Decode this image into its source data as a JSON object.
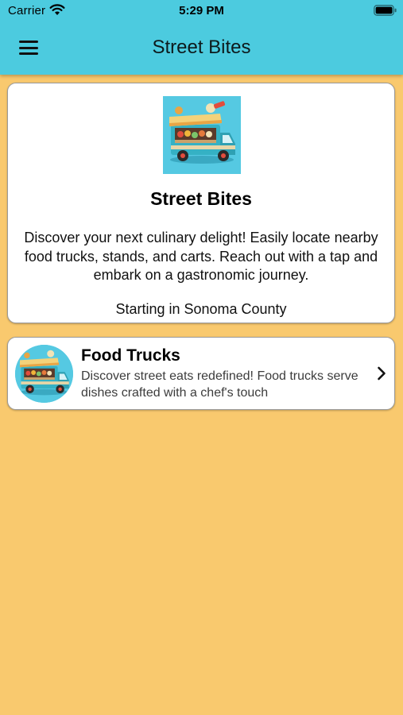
{
  "status_bar": {
    "carrier": "Carrier",
    "time": "5:29 PM",
    "icons": [
      "wifi-icon",
      "battery-icon"
    ]
  },
  "nav": {
    "title": "Street Bites",
    "menu_icon": "hamburger-menu-icon"
  },
  "intro": {
    "image": "food-truck-illustration",
    "title": "Street Bites",
    "description": "Discover your next culinary delight! Easily locate nearby food trucks, stands, and carts. Reach out with a tap and embark on a gastronomic journey.",
    "location": "Starting in Sonoma County"
  },
  "categories": [
    {
      "image": "food-truck-illustration",
      "title": "Food Trucks",
      "description": "Discover street eats redefined! Food trucks serve dishes crafted with a chef's touch",
      "icon": "chevron-right-icon"
    }
  ],
  "colors": {
    "header": "#4CCBDF",
    "background": "#F9C96E",
    "card": "#FFFFFF",
    "image_bg": "#55C9E2"
  }
}
